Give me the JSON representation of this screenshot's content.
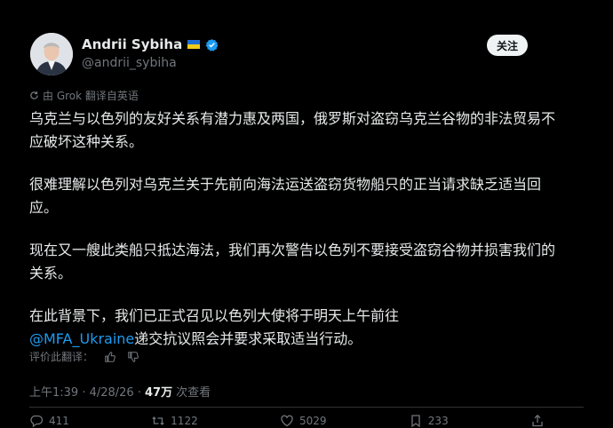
{
  "author": {
    "display_name": "Andrii Sybiha",
    "handle": "@andrii_sybiha",
    "flag_icon": "ukraine-flag-icon",
    "verified_icon": "verified-badge-icon"
  },
  "follow_label": "关注",
  "translation_note": "由 Grok 翻译自英语",
  "paragraphs": {
    "p1": "乌克兰与以色列的友好关系有潜力惠及两国，俄罗斯对盗窃乌克兰谷物的非法贸易不应破坏这种关系。",
    "p2": "很难理解以色列对乌克兰关于先前向海法运送盗窃货物船只的正当请求缺乏适当回应。",
    "p3": "现在又一艘此类船只抵达海法，我们再次警告以色列不要接受盗窃谷物并损害我们的关系。",
    "p4_before": "在此背景下，我们已正式召见以色列大使将于明天上午前往",
    "p4_mention": "@MFA_Ukraine",
    "p4_after": "递交抗议照会并要求采取适当行动。"
  },
  "rate_label": "评价此翻译：",
  "meta": {
    "time": "上午1:39 · 4/28/26 · ",
    "views": "47万",
    "views_label": " 次查看"
  },
  "actions": {
    "reply_count": "411",
    "retweet_count": "1122",
    "like_count": "5029",
    "bookmark_count": "233"
  },
  "colors": {
    "background": "#000000",
    "text": "#e7e9ea",
    "muted": "#71767b",
    "link": "#1d9bf0",
    "verified": "#1d9bf0",
    "flag_blue": "#1d6fd6",
    "flag_yellow": "#f3cd19"
  }
}
